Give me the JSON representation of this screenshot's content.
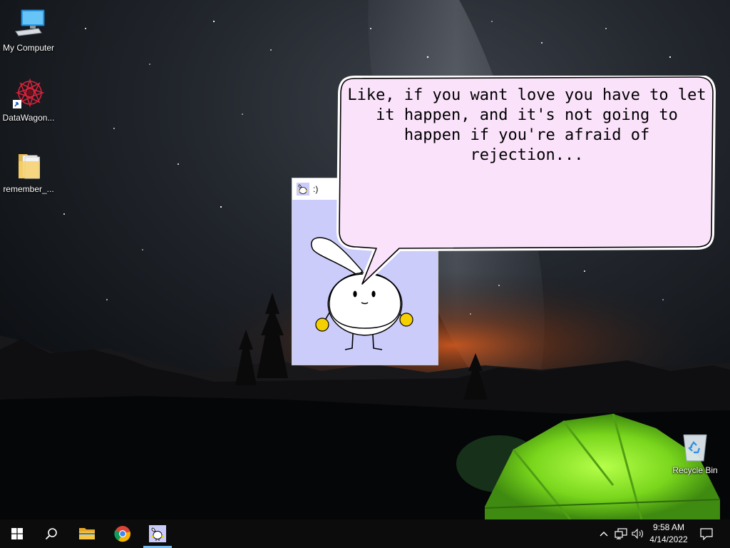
{
  "desktop": {
    "icons": [
      {
        "label": "My Computer",
        "icon": "monitor-icon"
      },
      {
        "label": "DataWagon...",
        "icon": "datawagon-shortcut-icon"
      },
      {
        "label": "remember_...",
        "icon": "folder-icon"
      },
      {
        "label": "Recycle Bin",
        "icon": "recycle-bin-icon"
      }
    ]
  },
  "buddy_window": {
    "title": ":)",
    "icon": "bunny-icon",
    "client_color": "#ccccfb"
  },
  "speech_bubble": {
    "text": "Like, if you want love you have to let it happen, and it's not going to happen if you're afraid of rejection...",
    "fill_color": "#fbe2fb"
  },
  "taskbar": {
    "buttons": [
      {
        "name": "start",
        "icon": "windows-logo-icon"
      },
      {
        "name": "search",
        "icon": "search-icon"
      },
      {
        "name": "file-explorer",
        "icon": "folder-icon"
      },
      {
        "name": "chrome",
        "icon": "chrome-icon"
      },
      {
        "name": "buddy-app",
        "icon": "bunny-icon"
      }
    ],
    "tray": {
      "icons": [
        "chevron-up-icon",
        "network-icon",
        "volume-icon"
      ],
      "time": "9:58 AM",
      "date": "4/14/2022",
      "notification_icon": "notification-icon"
    },
    "accent_color": "#76b9ed"
  }
}
